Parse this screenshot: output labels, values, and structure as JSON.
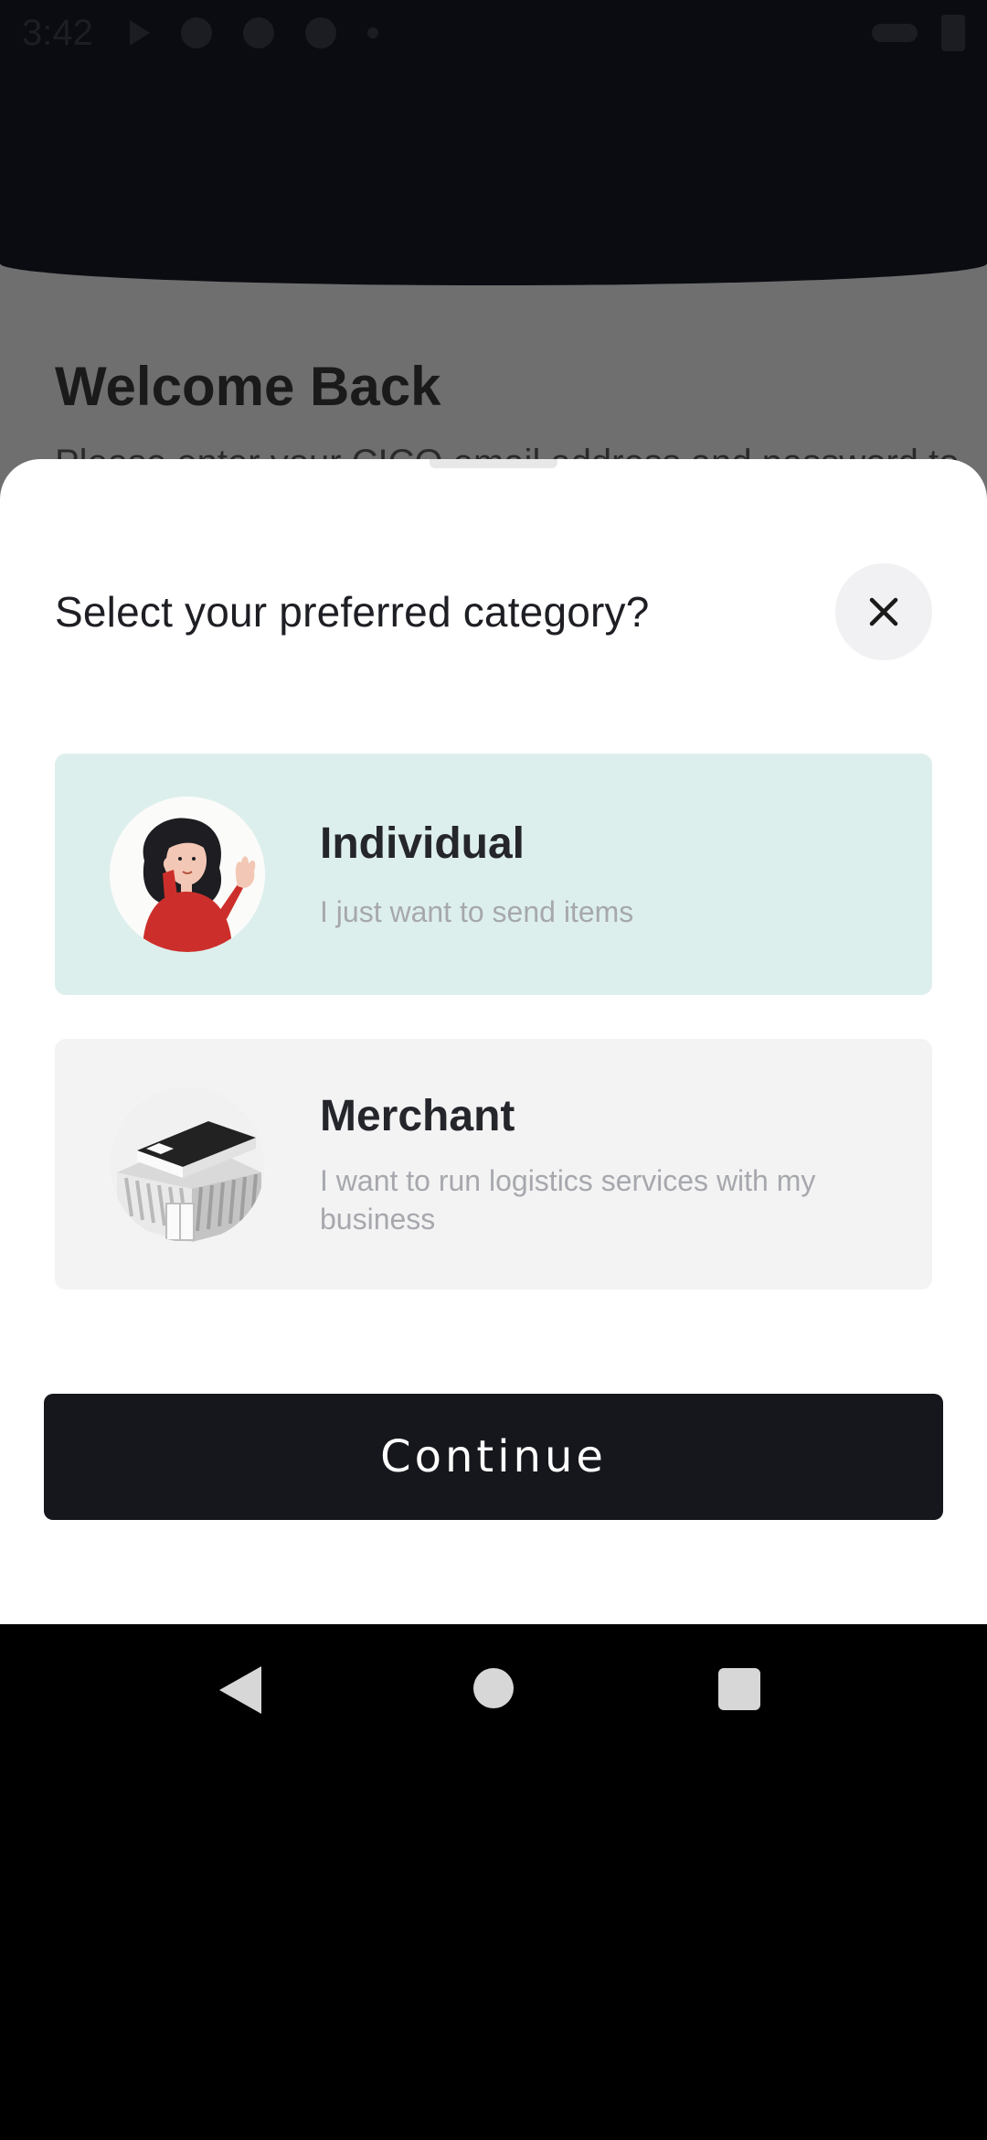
{
  "status_bar": {
    "time": "3:42",
    "icons": [
      "play-icon",
      "ssd-icon",
      "recycle-icon",
      "globe-icon",
      "dot-icon",
      "data-arrows-icon",
      "battery-icon"
    ]
  },
  "background": {
    "title": "Welcome Back",
    "subtitle": "Please enter your CICO email address and password to"
  },
  "sheet": {
    "title": "Select your preferred category?",
    "options": [
      {
        "title": "Individual",
        "description": "I just want to send items",
        "selected": true,
        "icon": "person-waving-illustration"
      },
      {
        "title": "Merchant",
        "description": "I want to run logistics services with my business",
        "selected": false,
        "icon": "building-illustration"
      }
    ],
    "continue_label": "Continue"
  },
  "colors": {
    "selected_bg": "#ddefed",
    "unselected_bg": "#f3f3f4",
    "button_bg": "#16171c",
    "header_dark": "#0a0c12"
  },
  "nav_bar": {
    "icons": [
      "back-icon",
      "home-icon",
      "recents-icon"
    ]
  }
}
